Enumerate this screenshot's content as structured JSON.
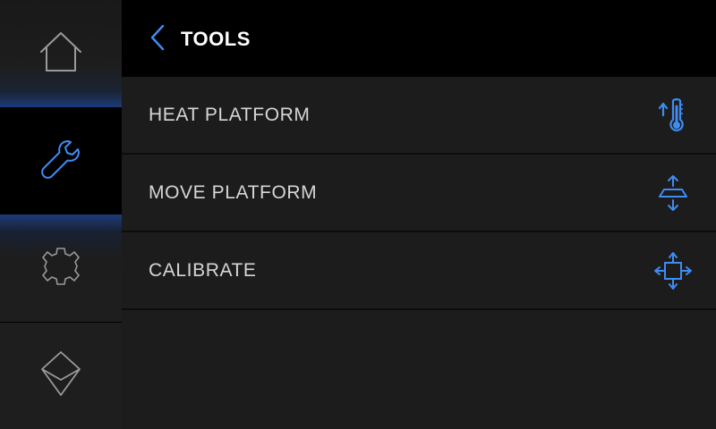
{
  "header": {
    "title": "TOOLS"
  },
  "sidebar": {
    "items": [
      {
        "name": "home",
        "icon": "home-icon",
        "active": false
      },
      {
        "name": "tools",
        "icon": "wrench-icon",
        "active": true
      },
      {
        "name": "settings",
        "icon": "gear-icon",
        "active": false
      },
      {
        "name": "info",
        "icon": "octahedron-icon",
        "active": false
      }
    ]
  },
  "menu": {
    "items": [
      {
        "label": "HEAT PLATFORM",
        "icon": "thermometer-up-icon"
      },
      {
        "label": "MOVE PLATFORM",
        "icon": "platform-up-down-icon"
      },
      {
        "label": "CALIBRATE",
        "icon": "calibrate-arrows-icon"
      }
    ]
  },
  "colors": {
    "accent": "#3f8cf2",
    "icon_gray": "#9a9a9a",
    "text": "#d6d6d6",
    "title": "#ffffff",
    "header_bg": "#000000",
    "list_bg": "#1c1c1c"
  }
}
